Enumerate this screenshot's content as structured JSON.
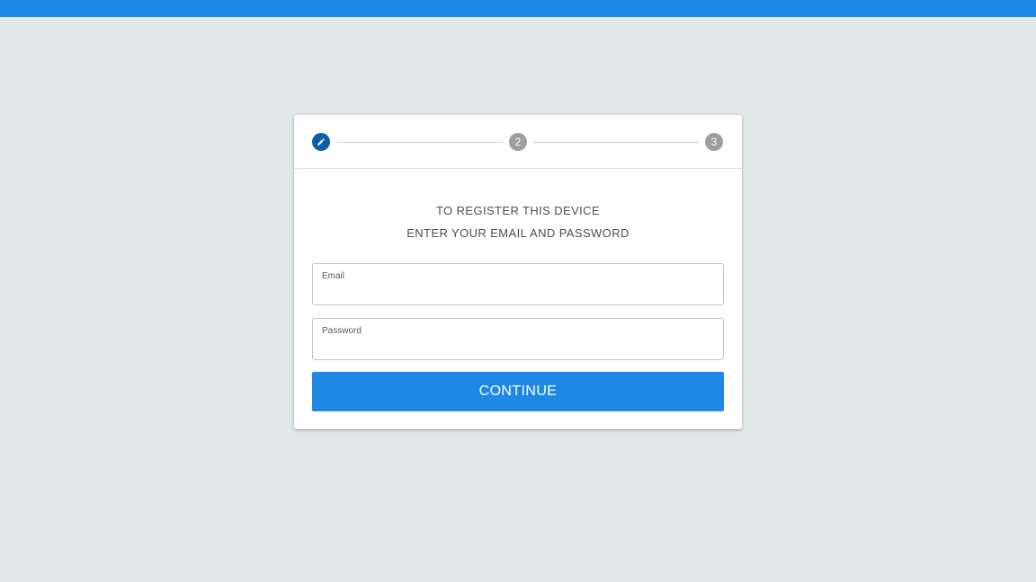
{
  "colors": {
    "accent": "#1e88e5",
    "active_step": "#0d5ea8",
    "inactive_step": "#9e9e9e",
    "background": "#e1e7e8"
  },
  "stepper": {
    "steps": [
      {
        "label": "",
        "icon": "pencil-icon",
        "state": "active"
      },
      {
        "label": "2",
        "state": "inactive"
      },
      {
        "label": "3",
        "state": "inactive"
      }
    ]
  },
  "instructions": {
    "line1": "TO REGISTER THIS DEVICE",
    "line2": "ENTER YOUR EMAIL AND PASSWORD"
  },
  "form": {
    "email": {
      "label": "Email",
      "value": ""
    },
    "password": {
      "label": "Password",
      "value": ""
    }
  },
  "continue_label": "CONTINUE"
}
